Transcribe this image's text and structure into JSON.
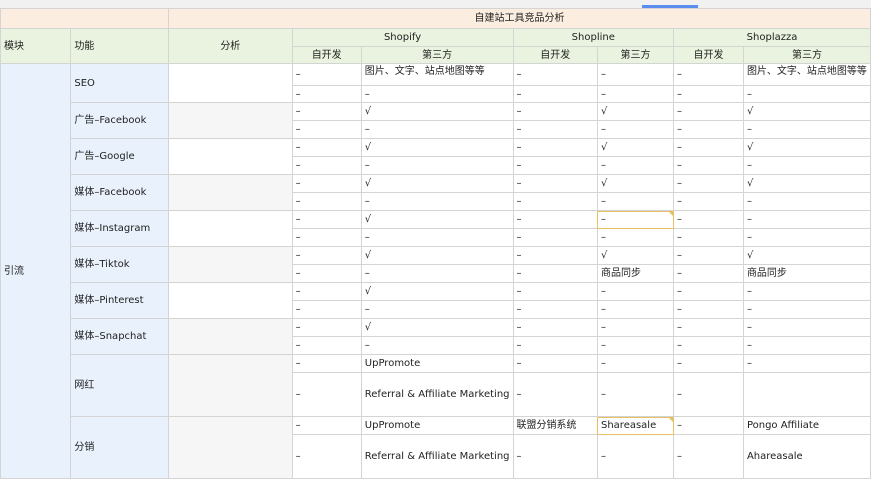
{
  "header": {
    "title": "自建站工具竞品分析",
    "col_module": "模块",
    "col_feature": "功能",
    "col_analysis": "分析",
    "platforms": [
      "Shopify",
      "Shopline",
      "Shoplazza"
    ],
    "self_dev": "自开发",
    "third_party": "第三方"
  },
  "module": "引流",
  "features": [
    {
      "name": "SEO",
      "rows": [
        [
          "–",
          "图片、文字、站点地图等等",
          "–",
          "–",
          "–",
          "图片、文字、站点地图等等"
        ],
        [
          "–",
          "–",
          "–",
          "–",
          "–",
          "–"
        ]
      ]
    },
    {
      "name": "广告–Facebook",
      "rows": [
        [
          "–",
          "√",
          "–",
          "√",
          "–",
          "√"
        ],
        [
          "–",
          "–",
          "–",
          "–",
          "–",
          "–"
        ]
      ]
    },
    {
      "name": "广告–Google",
      "rows": [
        [
          "–",
          "√",
          "–",
          "√",
          "–",
          "√"
        ],
        [
          "–",
          "–",
          "–",
          "–",
          "–",
          "–"
        ]
      ]
    },
    {
      "name": "媒体–Facebook",
      "rows": [
        [
          "–",
          "√",
          "–",
          "√",
          "–",
          "√"
        ],
        [
          "–",
          "–",
          "–",
          "–",
          "–",
          "–"
        ]
      ]
    },
    {
      "name": "媒体–Instagram",
      "rows": [
        [
          "–",
          "√",
          "–",
          "–",
          "–",
          "–"
        ],
        [
          "–",
          "–",
          "–",
          "–",
          "–",
          "–"
        ]
      ]
    },
    {
      "name": "媒体–Tiktok",
      "rows": [
        [
          "–",
          "√",
          "–",
          "√",
          "–",
          "√"
        ],
        [
          "–",
          "–",
          "–",
          "商品同步",
          "–",
          "商品同步"
        ]
      ]
    },
    {
      "name": "媒体–Pinterest",
      "rows": [
        [
          "–",
          "√",
          "–",
          "–",
          "–",
          "–"
        ],
        [
          "–",
          "–",
          "–",
          "–",
          "–",
          "–"
        ]
      ]
    },
    {
      "name": "媒体–Snapchat",
      "rows": [
        [
          "–",
          "√",
          "–",
          "–",
          "–",
          "–"
        ],
        [
          "–",
          "–",
          "–",
          "–",
          "–",
          "–"
        ]
      ]
    },
    {
      "name": "网红",
      "rows": [
        [
          "–",
          "UpPromote",
          "–",
          "–",
          "–",
          "–"
        ],
        [
          "–",
          "Referral & Affiliate Marketing",
          "–",
          "–",
          "–",
          ""
        ]
      ]
    },
    {
      "name": "分销",
      "rows": [
        [
          "–",
          "UpPromote",
          "联盟分销系统",
          "Shareasale",
          "–",
          "Pongo Affiliate"
        ],
        [
          "–",
          "Referral & Affiliate Marketing",
          "–",
          "–",
          "–",
          "Ahareasale"
        ]
      ]
    }
  ]
}
